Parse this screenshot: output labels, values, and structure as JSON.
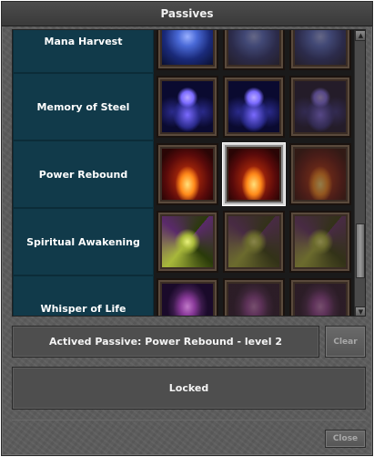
{
  "window": {
    "title": "Passives"
  },
  "passives": [
    {
      "name": "Mana Harvest",
      "theme": "arcane-blue",
      "active_slot": null
    },
    {
      "name": "Memory of Steel",
      "theme": "spirit-purple",
      "active_slot": null
    },
    {
      "name": "Power Rebound",
      "theme": "fire-red",
      "active_slot": 2
    },
    {
      "name": "Spiritual Awakening",
      "theme": "vortex-green",
      "active_slot": null
    },
    {
      "name": "Whisper of Life",
      "theme": "shade-violet",
      "active_slot": null
    }
  ],
  "status": {
    "active_text": "Actived Passive: Power Rebound - level 2",
    "locked_text": "Locked"
  },
  "buttons": {
    "clear": "Clear",
    "close": "Close"
  },
  "scrollbar": {
    "up_glyph": "▲",
    "down_glyph": "▼"
  },
  "colors": {
    "label_bg": "#113a4a",
    "arcane-blue": [
      "#1a2a7a",
      "#4a6ad8",
      "#0a1030"
    ],
    "spirit-purple": [
      "#2a2a8a",
      "#7a6aff",
      "#0a0a30"
    ],
    "fire-red": [
      "#5a0a0a",
      "#ff8a1a",
      "#ffe07a"
    ],
    "vortex-green": [
      "#2a3a0a",
      "#a8b83a",
      "#5a2a6a"
    ],
    "shade-violet": [
      "#1a0a2a",
      "#8a3a9a",
      "#3a1a4a"
    ]
  }
}
